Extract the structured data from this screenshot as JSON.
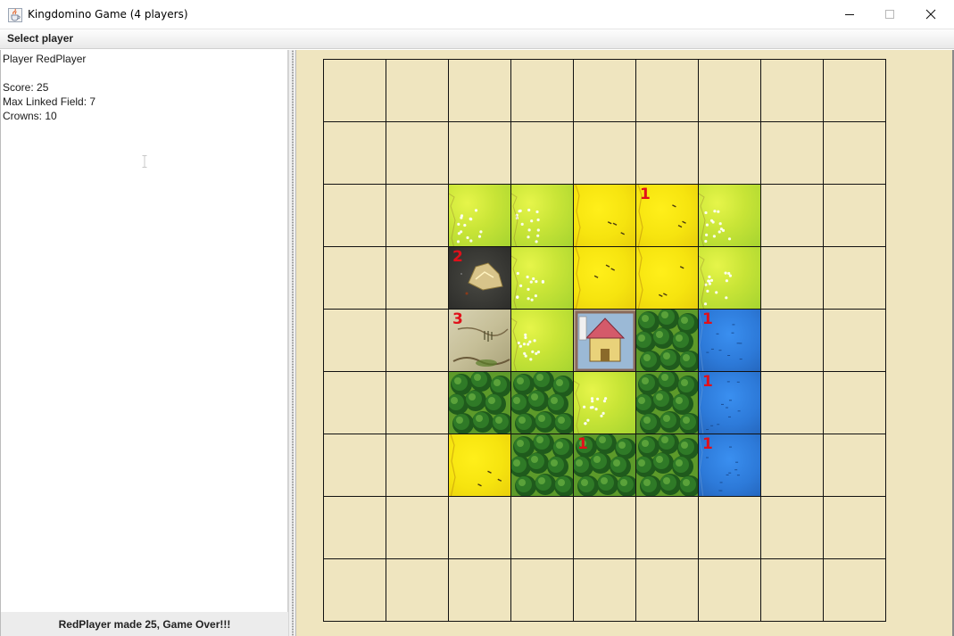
{
  "window": {
    "title": "Kingdomino Game (4 players)",
    "app_icon": "java-cup-icon",
    "minimize_icon": "minimize-icon",
    "maximize_icon": "maximize-icon",
    "close_icon": "close-icon"
  },
  "menu": {
    "items": [
      "Select player"
    ]
  },
  "player_info": {
    "player_line": "Player RedPlayer",
    "score_line": "Score: 25",
    "max_linked_line": "Max Linked Field: 7",
    "crowns_line": "Crowns: 10"
  },
  "status": {
    "message": "RedPlayer made 25, Game Over!!!"
  },
  "board": {
    "size": 9,
    "terrain_colors": {
      "empty": "#efe5bf",
      "meadow": "#c9e537",
      "wheat": "#f6e40f",
      "forest": "#3f7d1e",
      "water": "#2d7ad9",
      "mine": "#2d2d2a",
      "swamp": "#c6bf98",
      "castle": "#b8a88c"
    },
    "crown_color": "#e0101a",
    "rows": [
      [
        "empty",
        "empty",
        "empty",
        "empty",
        "empty",
        "empty",
        "empty",
        "empty",
        "empty"
      ],
      [
        "empty",
        "empty",
        "empty",
        "empty",
        "empty",
        "empty",
        "empty",
        "empty",
        "empty"
      ],
      [
        "empty",
        "empty",
        "meadow",
        "meadow",
        "wheat",
        "wheat",
        "meadow",
        "empty",
        "empty"
      ],
      [
        "empty",
        "empty",
        "mine",
        "meadow",
        "wheat",
        "wheat",
        "meadow",
        "empty",
        "empty"
      ],
      [
        "empty",
        "empty",
        "swamp",
        "meadow",
        "castle",
        "forest",
        "water",
        "empty",
        "empty"
      ],
      [
        "empty",
        "empty",
        "forest",
        "forest",
        "meadow",
        "forest",
        "water",
        "empty",
        "empty"
      ],
      [
        "empty",
        "empty",
        "wheat",
        "forest",
        "forest",
        "forest",
        "water",
        "empty",
        "empty"
      ],
      [
        "empty",
        "empty",
        "empty",
        "empty",
        "empty",
        "empty",
        "empty",
        "empty",
        "empty"
      ],
      [
        "empty",
        "empty",
        "empty",
        "empty",
        "empty",
        "empty",
        "empty",
        "empty",
        "empty"
      ]
    ],
    "crowns": [
      [
        0,
        0,
        0,
        0,
        0,
        0,
        0,
        0,
        0
      ],
      [
        0,
        0,
        0,
        0,
        0,
        0,
        0,
        0,
        0
      ],
      [
        0,
        0,
        0,
        0,
        0,
        1,
        0,
        0,
        0
      ],
      [
        0,
        0,
        2,
        0,
        0,
        0,
        0,
        0,
        0
      ],
      [
        0,
        0,
        3,
        0,
        0,
        0,
        1,
        0,
        0
      ],
      [
        0,
        0,
        0,
        0,
        0,
        0,
        1,
        0,
        0
      ],
      [
        0,
        0,
        0,
        0,
        1,
        0,
        1,
        0,
        0
      ],
      [
        0,
        0,
        0,
        0,
        0,
        0,
        0,
        0,
        0
      ],
      [
        0,
        0,
        0,
        0,
        0,
        0,
        0,
        0,
        0
      ]
    ]
  }
}
